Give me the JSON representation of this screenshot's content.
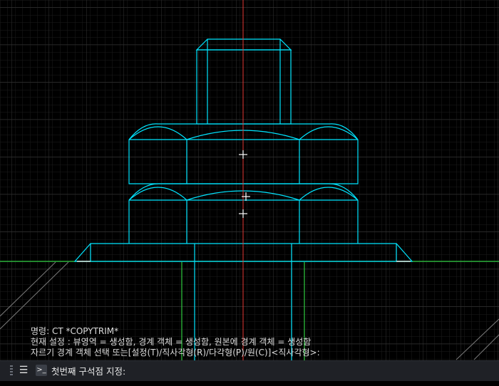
{
  "history": {
    "line1": "명령:  CT *COPYTRIM*",
    "line2": "현재 설정 : 뷰영역 = 생성함, 경계 객체 = 생성함, 원본에 경계 객체 = 생성함",
    "line3": "자르기 경계 객체 선택 또는[설정(T)/직사각형(R)/다각형(P)/원(C)]<직사각형>:"
  },
  "command_line": {
    "prompt": "첫번째 구석점 지정:",
    "menu_icon": "hamburger-menu-icon",
    "prompt_icon": "command-prompt-icon"
  },
  "colors": {
    "background": "#000000",
    "geometry": "#00e5ff",
    "axis_center": "#e53935",
    "ground": "#2ecc40",
    "grid": "#2a2a2a",
    "text": "#dcdcdc"
  }
}
